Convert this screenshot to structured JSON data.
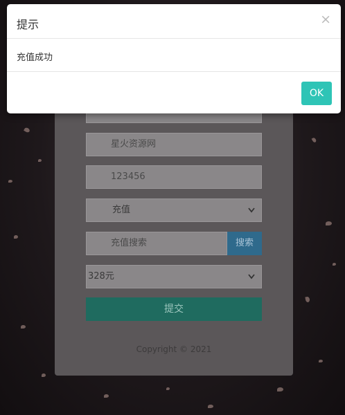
{
  "form": {
    "field_top_partial": "",
    "site_name": "星火资源网",
    "password": "123456",
    "action_select": "充值",
    "search_placeholder": "充值搜索",
    "search_button": "搜索",
    "amount_select": "328元",
    "submit_button": "提交",
    "copyright": "Copyright © 2021"
  },
  "dialog": {
    "title": "提示",
    "close_glyph": "×",
    "message": "充值成功",
    "ok_button": "OK"
  },
  "colors": {
    "ok_button": "#2ec4b6",
    "search_button": "#2f6a8c",
    "submit_button": "#1f6b5f"
  },
  "icons": {
    "chevron": "chevron-down-icon",
    "close": "close-icon"
  }
}
